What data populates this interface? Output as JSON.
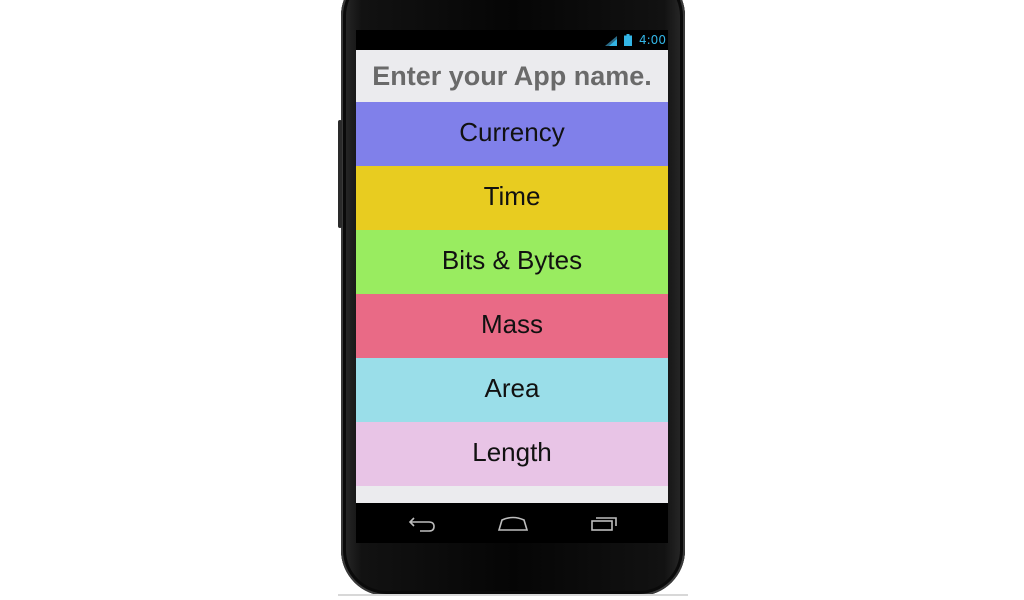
{
  "status_bar": {
    "time": "4:00",
    "accent_color": "#33b5e5",
    "icons": [
      "signal-icon",
      "battery-icon"
    ]
  },
  "app": {
    "title": "Enter your App name."
  },
  "categories": [
    {
      "label": "Currency",
      "color": "#8080ea"
    },
    {
      "label": "Time",
      "color": "#e8cc20"
    },
    {
      "label": "Bits & Bytes",
      "color": "#99ec60"
    },
    {
      "label": "Mass",
      "color": "#e96a86"
    },
    {
      "label": "Area",
      "color": "#9adee9"
    },
    {
      "label": "Length",
      "color": "#e8c4e6"
    }
  ],
  "nav_bar": {
    "icons": [
      "back-icon",
      "home-icon",
      "recent-apps-icon"
    ]
  }
}
